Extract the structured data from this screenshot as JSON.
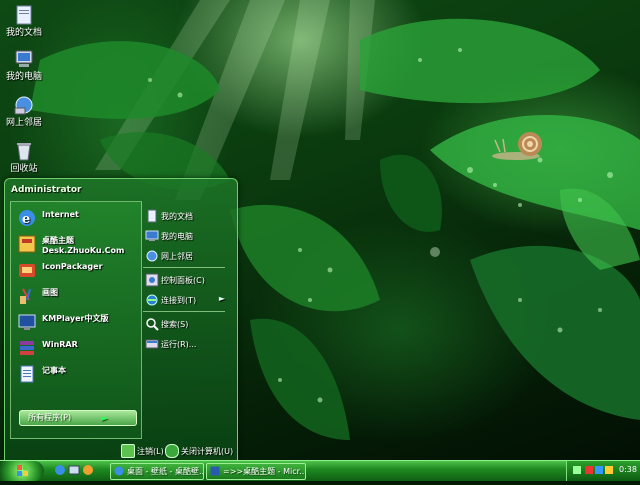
{
  "desktop": {
    "icons": [
      {
        "label": "我的文档",
        "icon": "my-documents-icon"
      },
      {
        "label": "我的电脑",
        "icon": "my-computer-icon"
      },
      {
        "label": "网上邻居",
        "icon": "network-icon"
      },
      {
        "label": "回收站",
        "icon": "recycle-bin-icon"
      }
    ]
  },
  "start_menu": {
    "user": "Administrator",
    "programs": [
      {
        "line1": "Internet",
        "line2": "",
        "icon": "ie-icon"
      },
      {
        "line1": "桌酷主题",
        "line2": "Desk.ZhuoKu.Com",
        "icon": "zhuoku-icon"
      },
      {
        "line1": "IconPackager",
        "line2": "",
        "icon": "iconpackager-icon"
      },
      {
        "line1": "画图",
        "line2": "",
        "icon": "paint-icon"
      },
      {
        "line1": "KMPlayer中文版",
        "line2": "",
        "icon": "kmplayer-icon"
      },
      {
        "line1": "WinRAR",
        "line2": "",
        "icon": "winrar-icon"
      },
      {
        "line1": "记事本",
        "line2": "",
        "icon": "notepad-icon"
      }
    ],
    "all_programs": "所有程序(P)",
    "places": [
      {
        "label": "我的文档",
        "icon": "documents-icon"
      },
      {
        "label": "我的电脑",
        "icon": "computer-icon"
      },
      {
        "label": "网上邻居",
        "icon": "network-icon"
      },
      {
        "label": "控制面板(C)",
        "icon": "control-panel-icon"
      },
      {
        "label": "连接到(T)",
        "icon": "connect-icon"
      },
      {
        "label": "搜索(S)",
        "icon": "search-icon"
      },
      {
        "label": "运行(R)...",
        "icon": "run-icon"
      }
    ],
    "logoff": "注销(L)",
    "shutdown": "关闭计算机(U)"
  },
  "taskbar": {
    "tasks": [
      {
        "label": "桌面 - 壁纸 - 桌酷壁...",
        "icon": "browser-icon"
      },
      {
        "label": "=>>桌酷主题 - Micr...",
        "icon": "word-icon"
      }
    ],
    "clock": "0:38"
  },
  "colors": {
    "accent": "#2c9a2c",
    "glass": "#1e7828",
    "text": "#ffffff"
  }
}
